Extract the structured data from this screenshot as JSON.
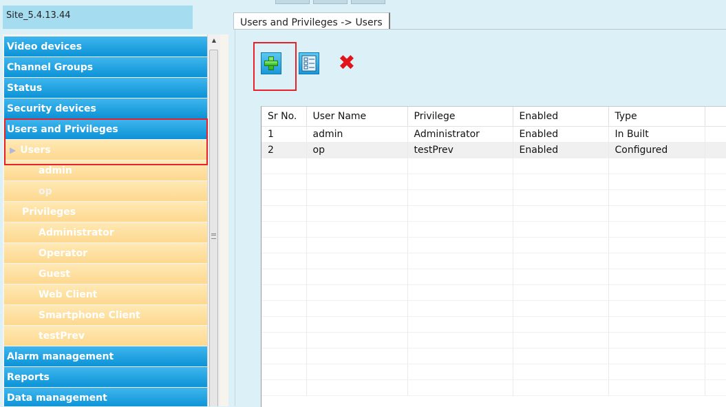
{
  "site": {
    "name": "Site_5.4.13.44"
  },
  "tree": {
    "items": [
      {
        "label": "Video devices",
        "kind": "category",
        "name": "tree-video-devices"
      },
      {
        "label": "Channel Groups",
        "kind": "category",
        "name": "tree-channel-groups"
      },
      {
        "label": "Status",
        "kind": "category",
        "name": "tree-status"
      },
      {
        "label": "Security devices",
        "kind": "category",
        "name": "tree-security-devices"
      },
      {
        "label": "Users and Privileges",
        "kind": "category",
        "name": "tree-users-and-privileges"
      },
      {
        "label": "Users",
        "kind": "sub-selected",
        "name": "tree-users"
      },
      {
        "label": "admin",
        "kind": "leaf",
        "name": "tree-user-admin"
      },
      {
        "label": "op",
        "kind": "leaf",
        "name": "tree-user-op"
      },
      {
        "label": "Privileges",
        "kind": "group",
        "name": "tree-privileges"
      },
      {
        "label": "Administrator",
        "kind": "leaf",
        "name": "tree-privilege-administrator"
      },
      {
        "label": "Operator",
        "kind": "leaf",
        "name": "tree-privilege-operator"
      },
      {
        "label": "Guest",
        "kind": "leaf",
        "name": "tree-privilege-guest"
      },
      {
        "label": "Web Client",
        "kind": "leaf",
        "name": "tree-privilege-web-client"
      },
      {
        "label": "Smartphone Client",
        "kind": "leaf",
        "name": "tree-privilege-smartphone-client"
      },
      {
        "label": "testPrev",
        "kind": "leaf",
        "name": "tree-privilege-testprev"
      },
      {
        "label": "Alarm management",
        "kind": "category",
        "name": "tree-alarm-management"
      },
      {
        "label": "Reports",
        "kind": "category",
        "name": "tree-reports"
      },
      {
        "label": "Data management",
        "kind": "category",
        "name": "tree-data-management"
      }
    ]
  },
  "tab": {
    "label": "Users and Privileges -> Users"
  },
  "toolbar": {
    "add_icon": "add-plus-icon",
    "details_icon": "list-details-icon",
    "delete_icon": "delete-x-icon",
    "delete_glyph": "✖"
  },
  "table": {
    "columns": [
      "Sr No.",
      "User Name",
      "Privilege",
      "Enabled",
      "Type",
      ""
    ],
    "rows": [
      [
        "1",
        "admin",
        "Administrator",
        "Enabled",
        "In Built",
        ""
      ],
      [
        "2",
        "op",
        "testPrev",
        "Enabled",
        "Configured",
        ""
      ]
    ],
    "empty_rows": 15
  },
  "colors": {
    "category": "#0c92d6",
    "subitem": "#fdd88f",
    "highlight": "#e8202a",
    "background": "#dbf0f7"
  }
}
